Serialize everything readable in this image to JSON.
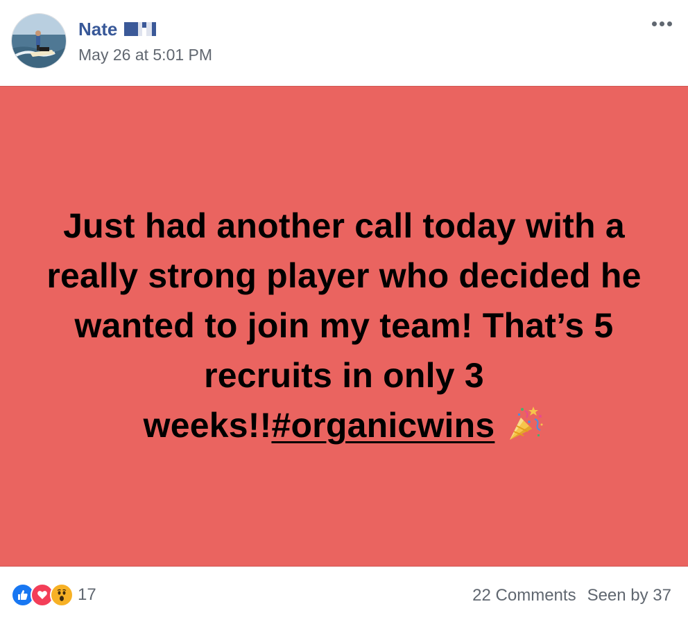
{
  "post": {
    "author": {
      "name": "Nate"
    },
    "timestamp": "May 26 at 5:01 PM",
    "more_icon": "more-options-icon",
    "background_color": "#ea6460",
    "text_main": "Just had another call today with a really strong player who decided he wanted to join my team! That’s 5 recruits in only 3 weeks!!",
    "hashtag": "#organicwins",
    "emoji": "party-popper-icon"
  },
  "footer": {
    "reactions": [
      "like-icon",
      "love-icon",
      "wow-icon"
    ],
    "reaction_count": "17",
    "comments": "22 Comments",
    "seen_by": "Seen by 37"
  },
  "colors": {
    "link_blue": "#385898",
    "muted_text": "#616770",
    "like_blue": "#1877f2",
    "love_red": "#f33e58",
    "wow_yellow": "#f7b125"
  }
}
